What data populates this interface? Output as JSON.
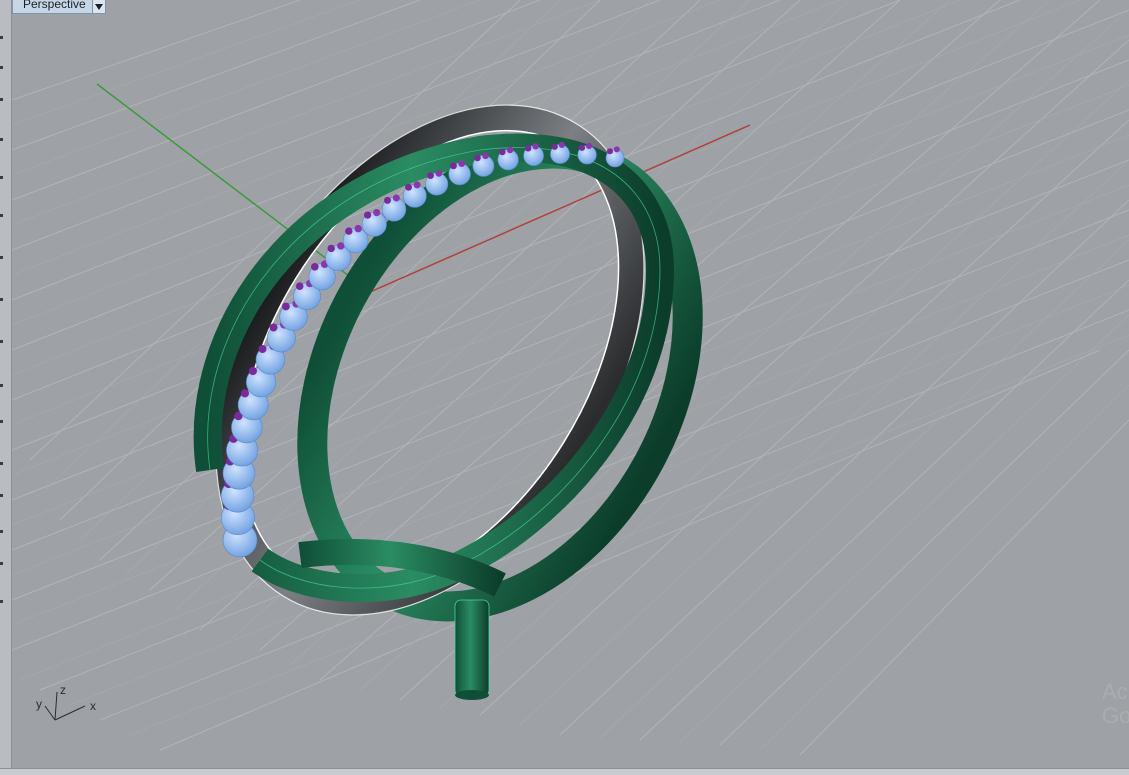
{
  "viewport": {
    "title": "Perspective",
    "projection": "perspective",
    "grid": true,
    "world_axes": {
      "x_color": "#b0413e",
      "y_color": "#3c9a3c"
    }
  },
  "axis_widget": {
    "x": "x",
    "y": "y",
    "z": "z"
  },
  "model": {
    "object": "ring",
    "shank_color": "#1f7a55",
    "selected_edge_color": "#ffffff",
    "gem_color": "#8ab8f0",
    "prong_color": "#7a2a9a",
    "gem_count": 26
  },
  "watermark": {
    "line1": "Ac",
    "line2": "Go"
  },
  "colors": {
    "background": "#9ea2a6",
    "grid_line": "#b4b8bc",
    "tab_bg": "#c7d6e6"
  }
}
